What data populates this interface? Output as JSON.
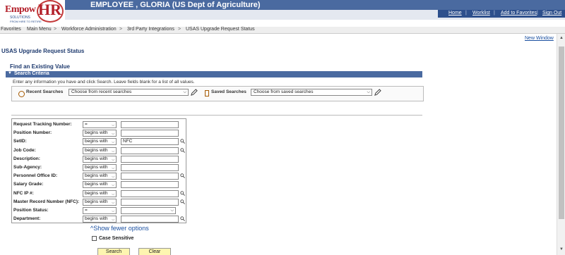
{
  "header": {
    "logo_main": "EmpowHR",
    "logo_word1": "Empow",
    "logo_word2": "HR",
    "logo_sub1": "SOLUTIONS",
    "logo_sub2": "FROM HIRE TO RETIRE",
    "user_name": "EMPLOYEE , GLORIA (US Dept of Agriculture)",
    "links": [
      "Home",
      "Worklist",
      "Add to Favorites",
      "Sign Out"
    ]
  },
  "breadcrumb": [
    "Favorites",
    "Main Menu",
    "Workforce Administration",
    "3rd Party Integrations",
    "USAS Upgrade Request Status"
  ],
  "new_window": "New Window",
  "page_title": "USAS Upgrade Request Status",
  "section_title": "Find an Existing Value",
  "criteria": {
    "label": "Search Criteria",
    "instructions": "Enter any information you have and click Search. Leave fields blank for a list of all values.",
    "recent_label": "Recent Searches",
    "recent_placeholder": "Choose from recent searches",
    "saved_label": "Saved Searches",
    "saved_placeholder": "Choose from saved searches"
  },
  "fields": [
    {
      "label": "Request Tracking Number:",
      "operator": "=",
      "value": "",
      "lookup": false,
      "value_type": "input"
    },
    {
      "label": "Position Number:",
      "operator": "begins with",
      "value": "",
      "lookup": false,
      "value_type": "input"
    },
    {
      "label": "SetID:",
      "operator": "begins with",
      "value": "NFC",
      "lookup": true,
      "value_type": "input"
    },
    {
      "label": "Job Code:",
      "operator": "begins with",
      "value": "",
      "lookup": true,
      "value_type": "input"
    },
    {
      "label": "Description:",
      "operator": "begins with",
      "value": "",
      "lookup": false,
      "value_type": "input"
    },
    {
      "label": "Sub-Agency:",
      "operator": "begins with",
      "value": "",
      "lookup": false,
      "value_type": "input"
    },
    {
      "label": "Personnel Office ID:",
      "operator": "begins with",
      "value": "",
      "lookup": true,
      "value_type": "input"
    },
    {
      "label": "Salary Grade:",
      "operator": "begins with",
      "value": "",
      "lookup": false,
      "value_type": "input"
    },
    {
      "label": "NFC IP #:",
      "operator": "begins with",
      "value": "",
      "lookup": true,
      "value_type": "input"
    },
    {
      "label": "Master Record Number (NFC):",
      "operator": "begins with",
      "value": "",
      "lookup": true,
      "value_type": "input"
    },
    {
      "label": "Position Status:",
      "operator": "=",
      "value": "",
      "lookup": false,
      "value_type": "select"
    },
    {
      "label": "Department:",
      "operator": "begins with",
      "value": "",
      "lookup": true,
      "value_type": "input"
    }
  ],
  "fewer_options": "Show fewer options",
  "case_sensitive": "Case Sensitive",
  "buttons": {
    "search": "Search",
    "clear": "Clear"
  },
  "colors": {
    "header_blue": "#4a6aa0",
    "nav_blue": "#2d4f8c",
    "logo_red": "#b3202a",
    "button_yellow": "#fdf5b0"
  }
}
